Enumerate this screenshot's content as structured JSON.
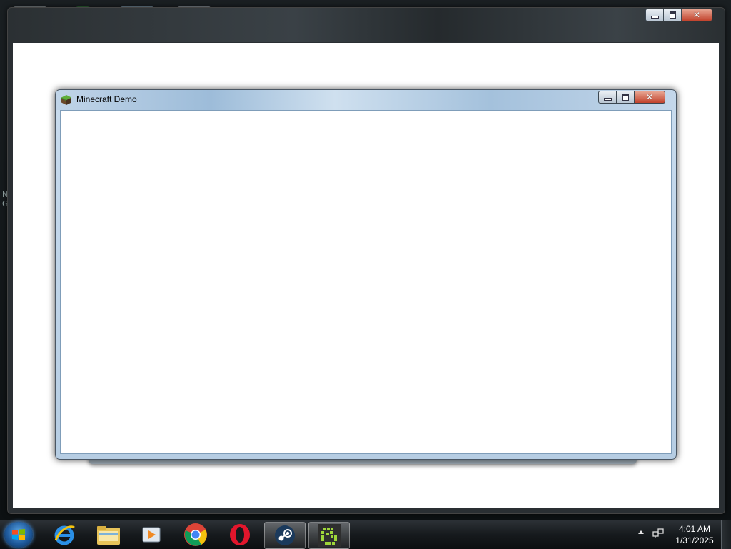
{
  "minecraft_window": {
    "title": "Minecraft Demo",
    "icon": "grass-block-icon"
  },
  "taskbar": {
    "start_icon": "windows-start-icon",
    "pinned": [
      {
        "name": "internet-explorer-icon"
      },
      {
        "name": "file-explorer-icon"
      },
      {
        "name": "media-player-icon"
      },
      {
        "name": "chrome-icon"
      },
      {
        "name": "opera-icon"
      },
      {
        "name": "steam-icon"
      },
      {
        "name": "minecraft-launcher-icon"
      }
    ],
    "clock": {
      "time": "4:01 AM",
      "date": "1/31/2025"
    }
  },
  "colors": {
    "titlebar_blue": "#9dbcd9",
    "close_red": "#c2432d",
    "taskbar_dark": "#161a1d"
  }
}
